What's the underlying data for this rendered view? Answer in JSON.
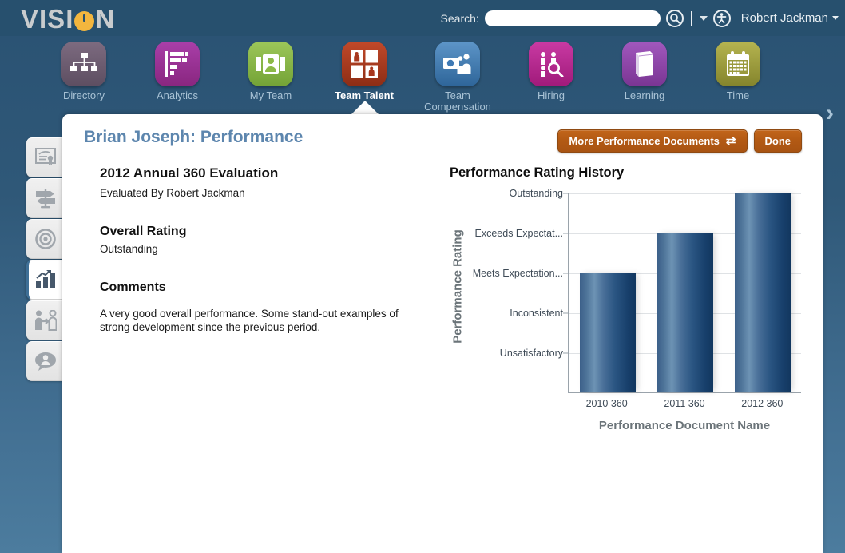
{
  "topbar": {
    "logo_text_1": "VISI",
    "logo_text_2": "N",
    "search_label": "Search:",
    "search_value": "",
    "search_placeholder": "",
    "username": "Robert Jackman"
  },
  "nav": {
    "items": [
      {
        "label": "Directory",
        "icon": "org-chart-icon",
        "color": "#6b5a6e",
        "active": false
      },
      {
        "label": "Analytics",
        "icon": "bar-chart-icon",
        "color": "#9b359b",
        "active": false
      },
      {
        "label": "My Team",
        "icon": "people-card-icon",
        "color": "#8cb947",
        "active": false
      },
      {
        "label": "Team Talent",
        "icon": "talent-grid-icon",
        "color": "#a8381f",
        "active": true
      },
      {
        "label": "Team Compensation",
        "icon": "money-people-icon",
        "color": "#3f7ab5",
        "active": false
      },
      {
        "label": "Hiring",
        "icon": "hiring-search-icon",
        "color": "#b8268f",
        "active": false
      },
      {
        "label": "Learning",
        "icon": "book-icon",
        "color": "#8e47a8",
        "active": false
      },
      {
        "label": "Time",
        "icon": "calendar-icon",
        "color": "#9a9a3c",
        "active": false
      }
    ],
    "next_arrow": "›"
  },
  "sidebar": {
    "items": [
      {
        "name": "certificate-icon",
        "label": "Certifications",
        "active": false
      },
      {
        "name": "signpost-icon",
        "label": "Career",
        "active": false
      },
      {
        "name": "target-icon",
        "label": "Goals",
        "active": false
      },
      {
        "name": "bar-chart-icon",
        "label": "Performance",
        "active": true
      },
      {
        "name": "people-transfer-icon",
        "label": "Succession",
        "active": false
      },
      {
        "name": "person-comment-icon",
        "label": "Feedback",
        "active": false
      }
    ]
  },
  "panel": {
    "title": "Brian Joseph: Performance",
    "more_docs_button": "More Performance Documents",
    "more_docs_icon": "⇄",
    "done_button": "Done"
  },
  "evaluation": {
    "doc_title": "2012 Annual 360 Evaluation",
    "evaluated_by": "Evaluated By Robert Jackman",
    "rating_heading": "Overall Rating",
    "rating_value": "Outstanding",
    "comments_heading": "Comments",
    "comments_text": "A very good overall performance. Some stand-out examples of strong development since the previous period."
  },
  "chart_data": {
    "type": "bar",
    "title": "Performance Rating History",
    "xlabel": "Performance Document Name",
    "ylabel": "Performance Rating",
    "categories": [
      "2010 360",
      "2011 360",
      "2012 360"
    ],
    "values": [
      3,
      4,
      5
    ],
    "value_labels": [
      "Meets Expectation...",
      "Exceeds Expectat...",
      "Outstanding"
    ],
    "ytick_labels": [
      "Outstanding",
      "Exceeds Expectat...",
      "Meets Expectation...",
      "Inconsistent",
      "Unsatisfactory"
    ],
    "ytick_values": [
      5,
      4,
      3,
      2,
      1
    ],
    "ylim": [
      0,
      5
    ],
    "grid": true,
    "legend": "none",
    "bar_color": "#2b5683"
  },
  "colors": {
    "page_bg_top": "#2a5273",
    "page_bg_bottom": "#4c7c9e",
    "topbar": "#27506e",
    "accent_orange": "#f3b63e",
    "button_orange": "#b35a14",
    "title_blue": "#5d86ae",
    "bar_blue": "#2b5683"
  }
}
